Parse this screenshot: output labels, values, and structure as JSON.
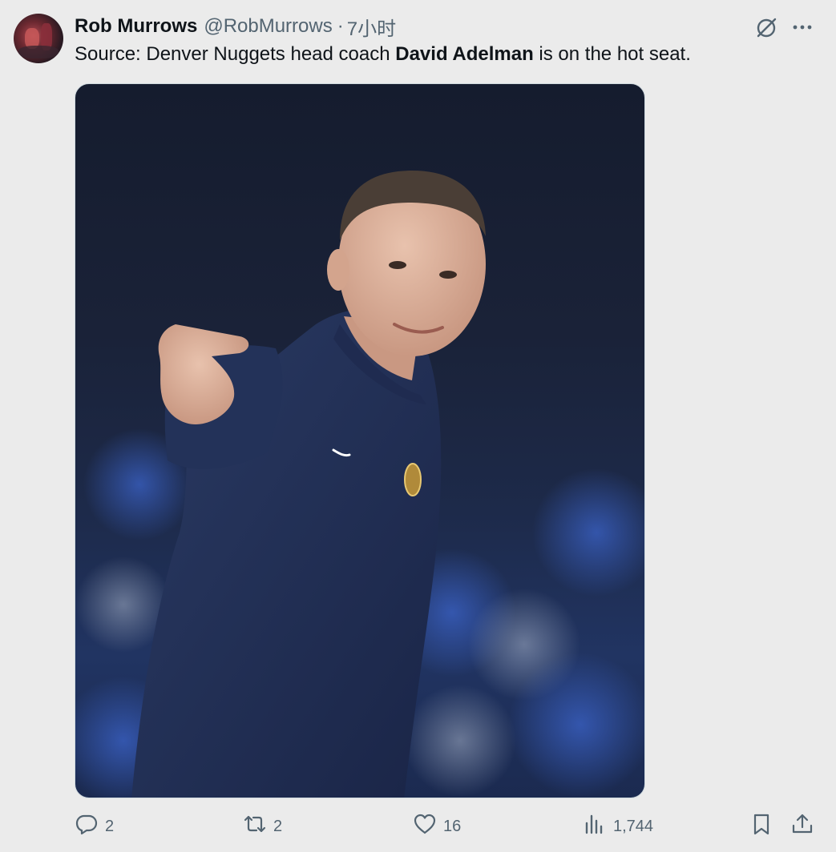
{
  "post": {
    "author": {
      "display_name": "Rob Murrows",
      "handle": "@RobMurrows",
      "separator": "·",
      "time": "7小时"
    },
    "text": {
      "prefix": "Source: Denver Nuggets head coach ",
      "bold": "David Adelman",
      "suffix": " is on the hot seat."
    },
    "media": {
      "alt_icon": "photo-coach-pointing"
    },
    "actions": {
      "reply_count": "2",
      "repost_count": "2",
      "like_count": "16",
      "views_count": "1,744"
    },
    "icons": {
      "grok": "grok-icon",
      "more": "more-icon",
      "reply": "reply-icon",
      "repost": "repost-icon",
      "like": "heart-icon",
      "views": "views-icon",
      "bookmark": "bookmark-icon",
      "share": "share-icon"
    },
    "colors": {
      "background": "#ebebeb",
      "text": "#0f1419",
      "secondary": "#536471"
    }
  }
}
